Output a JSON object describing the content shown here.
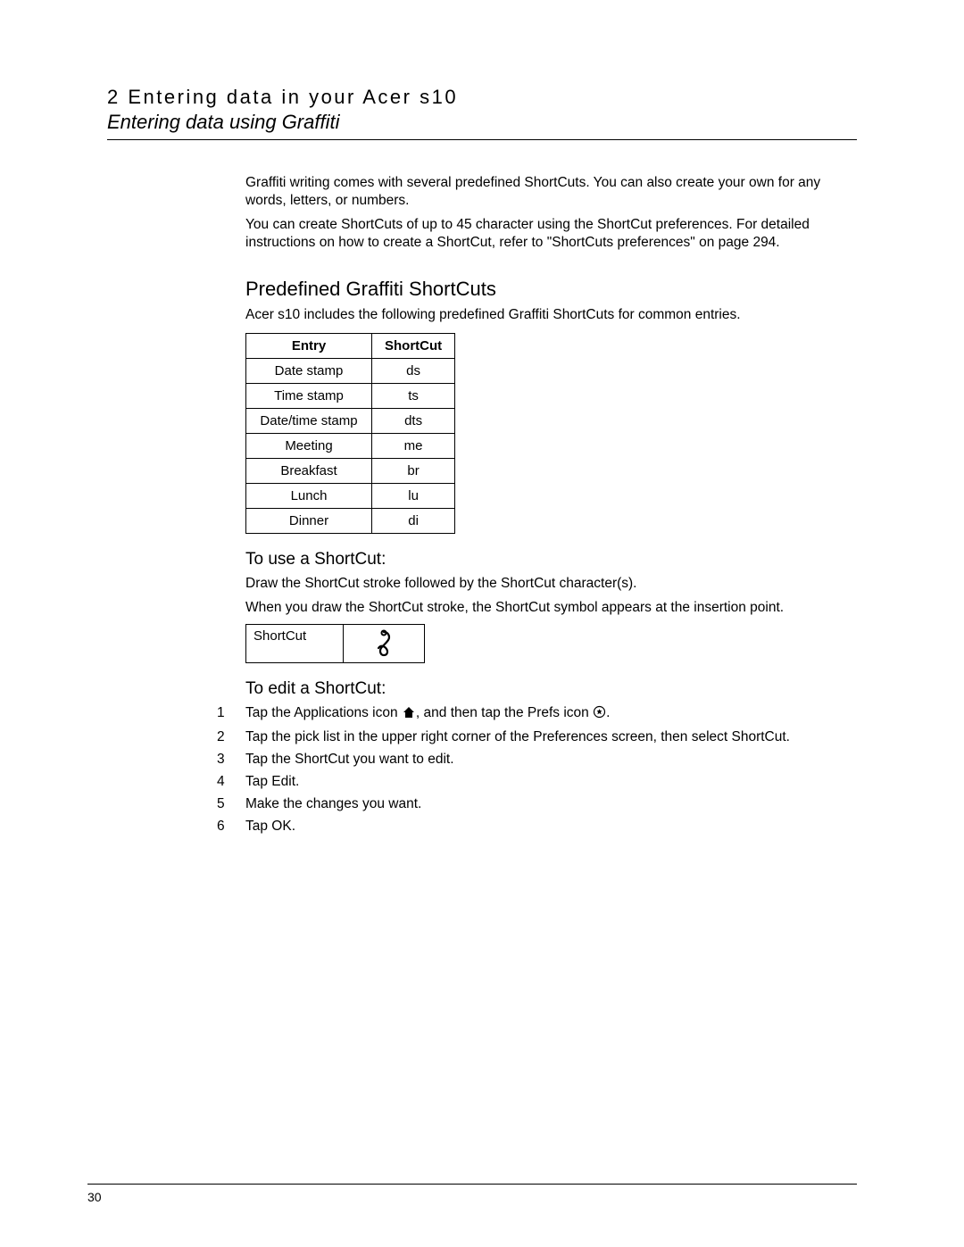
{
  "header": {
    "chapter": "2 Entering data in your Acer s10",
    "subtitle": "Entering data using Graffiti"
  },
  "intro": {
    "p1": "Graffiti writing comes with several predefined ShortCuts. You can also create your own for any words, letters, or numbers.",
    "p2": "You can create ShortCuts of up to 45 character using the ShortCut preferences. For detailed instructions on how to create a ShortCut, refer to \"ShortCuts preferences\" on page 294."
  },
  "section_predefined": {
    "heading": "Predefined Graffiti ShortCuts",
    "lead": "Acer s10 includes the following predefined Graffiti ShortCuts for common entries.",
    "table": {
      "col1": "Entry",
      "col2": "ShortCut",
      "rows": [
        {
          "entry": "Date stamp",
          "sc": "ds"
        },
        {
          "entry": "Time stamp",
          "sc": "ts"
        },
        {
          "entry": "Date/time stamp",
          "sc": "dts"
        },
        {
          "entry": "Meeting",
          "sc": "me"
        },
        {
          "entry": "Breakfast",
          "sc": "br"
        },
        {
          "entry": "Lunch",
          "sc": "lu"
        },
        {
          "entry": "Dinner",
          "sc": "di"
        }
      ]
    }
  },
  "section_use": {
    "heading": "To use a ShortCut:",
    "p1": "Draw the ShortCut stroke followed by the ShortCut character(s).",
    "p2": "When you draw the ShortCut stroke, the ShortCut symbol appears at the insertion point.",
    "stroke_label": "ShortCut"
  },
  "section_edit": {
    "heading": "To edit a ShortCut:",
    "step1_a": "Tap the Applications icon ",
    "step1_b": ", and then tap the Prefs icon ",
    "step1_c": ".",
    "step2": "Tap the pick list in the upper right corner of the Preferences screen, then select ShortCut.",
    "step3": "Tap the ShortCut you want to edit.",
    "step4": "Tap Edit.",
    "step5": "Make the changes you want.",
    "step6": "Tap OK."
  },
  "page_number": "30"
}
